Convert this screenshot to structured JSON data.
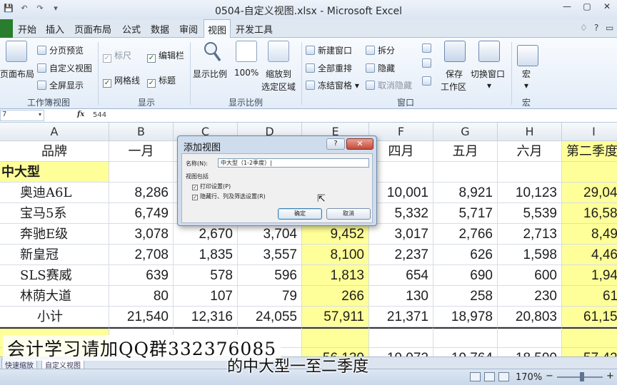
{
  "window": {
    "title": "0504-自定义视图.xlsx - Microsoft Excel",
    "qat": [
      "💾",
      "↶",
      "↷",
      "▾"
    ],
    "controls": [
      "—",
      "▢",
      "✕"
    ]
  },
  "tabs": [
    "开始",
    "插入",
    "页面布局",
    "公式",
    "数据",
    "审阅",
    "视图",
    "开发工具"
  ],
  "tabs_right": [
    "♢",
    "?",
    "▭",
    "✕"
  ],
  "ribbon": {
    "workbook_views": {
      "label": "工作簿视图",
      "page_layout": "页面布局",
      "page_break": "分页预览",
      "custom_views": "自定义视图",
      "full_screen": "全屏显示"
    },
    "show": {
      "label": "显示",
      "ruler": "标尺",
      "formula_bar": "编辑栏",
      "gridlines": "网格线",
      "headings": "标题"
    },
    "zoom": {
      "label": "显示比例",
      "zoom": "显示比例",
      "zoom100": "100%",
      "zoom_selection": "缩放到",
      "zoom_selection2": "选定区域"
    },
    "window": {
      "label": "窗口",
      "new_window": "新建窗口",
      "arrange_all": "全部重排",
      "freeze": "冻结窗格",
      "split": "拆分",
      "hide": "隐藏",
      "unhide": "取消隐藏",
      "save_ws": "保存",
      "save_ws2": "工作区",
      "switch": "切换窗口"
    },
    "macros": {
      "label": "宏",
      "macro": "宏"
    }
  },
  "formula_bar": {
    "name_box": "7",
    "fx": "fx",
    "value": "544"
  },
  "columns": [
    {
      "id": "A",
      "label": "A"
    },
    {
      "id": "B",
      "label": "B"
    },
    {
      "id": "C",
      "label": "C"
    },
    {
      "id": "D",
      "label": "D"
    },
    {
      "id": "E",
      "label": "E"
    },
    {
      "id": "F",
      "label": "F"
    },
    {
      "id": "G",
      "label": "G"
    },
    {
      "id": "H",
      "label": "H"
    },
    {
      "id": "I",
      "label": "I"
    }
  ],
  "sheet": {
    "header_row": [
      "品牌",
      "一月",
      "",
      "",
      "",
      "四月",
      "五月",
      "六月",
      "第二季度"
    ],
    "group_label": "中大型",
    "rows": [
      [
        "奥迪A6L",
        "8,286",
        "",
        "",
        "",
        "10,001",
        "8,921",
        "10,123",
        "29,04"
      ],
      [
        "宝马5系",
        "6,749",
        "",
        "",
        "",
        "5,332",
        "5,717",
        "5,539",
        "16,58"
      ],
      [
        "奔驰E级",
        "3,078",
        "2,670",
        "3,704",
        "9,452",
        "3,017",
        "2,766",
        "2,713",
        "8,49"
      ],
      [
        "新皇冠",
        "2,708",
        "1,835",
        "3,557",
        "8,100",
        "2,237",
        "626",
        "1,598",
        "4,46"
      ],
      [
        "SLS赛威",
        "639",
        "578",
        "596",
        "1,813",
        "654",
        "690",
        "600",
        "1,94"
      ],
      [
        "林荫大道",
        "80",
        "107",
        "79",
        "266",
        "130",
        "258",
        "230",
        "61"
      ],
      [
        "小计",
        "21,540",
        "12,316",
        "24,055",
        "57,911",
        "21,371",
        "18,978",
        "20,803",
        "61,15"
      ]
    ],
    "partial_row": [
      "",
      "",
      "",
      "",
      "56,130",
      "19,072",
      "19,764",
      "18,590",
      "57,42"
    ]
  },
  "sheet_tabs": [
    "快速缩放",
    "自定义视图"
  ],
  "status": {
    "zoom": "170%",
    "minus": "−",
    "plus": "+"
  },
  "dialog": {
    "title": "添加视图",
    "help": "?",
    "close": "✕",
    "name_label": "名称(N):",
    "name_value": "中大型（1-2季度）|",
    "include_label": "视图包括",
    "opt_print": "打印设置(P)",
    "opt_hidden": "隐藏行、列及筛选设置(R)",
    "ok": "确定",
    "cancel": "取消"
  },
  "overlay": {
    "watermark": "会计学习请加QQ群332376085",
    "subtitle": "的中大型一至二季度"
  },
  "colors": {
    "highlight": "#ffff99",
    "file_tab": "#2a7d2e",
    "close_btn": "#c24b38"
  }
}
